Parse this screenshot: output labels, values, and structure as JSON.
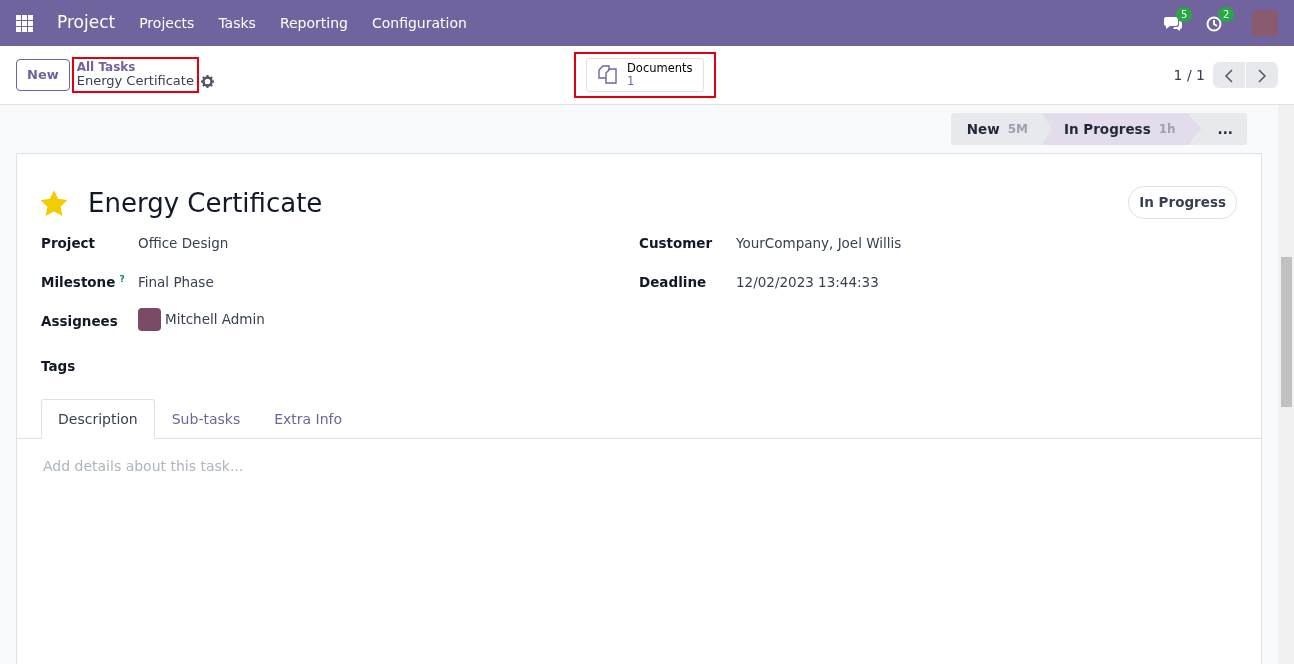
{
  "navbar": {
    "app_name": "Project",
    "menu": [
      "Projects",
      "Tasks",
      "Reporting",
      "Configuration"
    ],
    "messages_count": "5",
    "activities_count": "2"
  },
  "control_panel": {
    "new_button": "New",
    "breadcrumb": {
      "parent": "All Tasks",
      "current": "Energy Certificate",
      "highlighted": true
    },
    "documents_button": {
      "label": "Documents",
      "count": "1",
      "highlighted": true
    },
    "pager": "1 / 1"
  },
  "stages": [
    {
      "name": "New",
      "duration": "5M",
      "selected": false
    },
    {
      "name": "In Progress",
      "duration": "1h",
      "selected": true
    },
    {
      "name": "...",
      "selected": false
    }
  ],
  "task": {
    "starred": true,
    "title": "Energy Certificate",
    "state_badge": "In Progress",
    "left_fields": [
      {
        "label": "Project",
        "value": "Office Design",
        "kind": "text"
      },
      {
        "label": "Milestone",
        "help": "?",
        "value": "Final Phase",
        "kind": "text"
      },
      {
        "label": "Assignees",
        "value": "Mitchell Admin",
        "kind": "user"
      },
      {
        "label": "Tags"
      }
    ],
    "right_fields": [
      {
        "label": "Customer",
        "value": "YourCompany, Joel Willis",
        "kind": "text"
      },
      {
        "label": "Deadline",
        "value": "12/02/2023 13:44:33",
        "kind": "text"
      }
    ],
    "tabs": [
      {
        "label": "Description",
        "selected": true
      },
      {
        "label": "Sub-tasks",
        "selected": false
      },
      {
        "label": "Extra Info",
        "selected": false
      }
    ],
    "description": {
      "placeholder": "Add details about this task..."
    }
  }
}
